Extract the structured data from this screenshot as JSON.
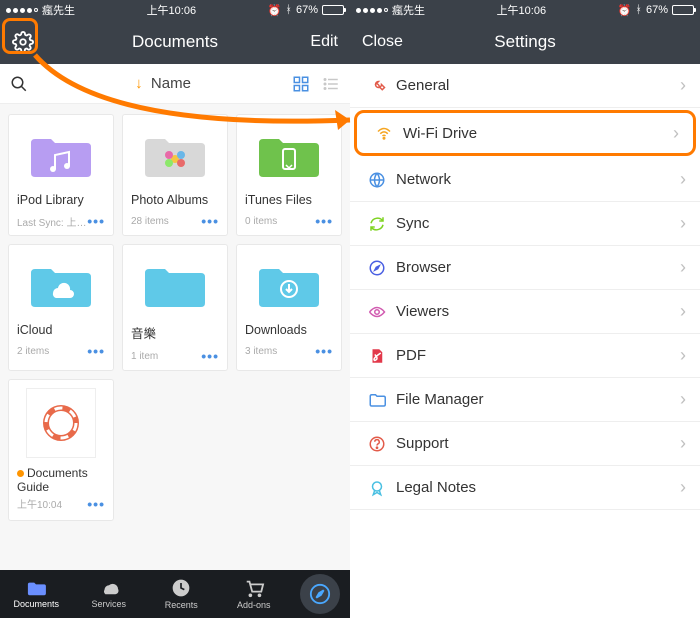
{
  "status": {
    "carrier": "瘋先生",
    "time": "上午10:06",
    "battery_pct": "67%"
  },
  "left": {
    "nav": {
      "title": "Documents",
      "edit": "Edit"
    },
    "sort": {
      "label": "Name"
    },
    "folders": [
      {
        "name": "iPod Library",
        "count": "Last Sync: 上午…",
        "color": "#b79df2",
        "icon": "music"
      },
      {
        "name": "Photo Albums",
        "count": "28 items",
        "color": "#d8d8d8",
        "icon": "flower"
      },
      {
        "name": "iTunes Files",
        "count": "0 items",
        "color": "#6fc24c",
        "icon": "phone"
      },
      {
        "name": "iCloud",
        "count": "2 items",
        "color": "#5fc9e8",
        "icon": "cloud"
      },
      {
        "name": "音樂",
        "count": "1 item",
        "color": "#5fc9e8",
        "icon": "plain"
      },
      {
        "name": "Downloads",
        "count": "3 items",
        "color": "#5fc9e8",
        "icon": "download"
      }
    ],
    "doc": {
      "name": "Documents Guide",
      "date": "上午10:04"
    },
    "tabs": [
      {
        "label": "Documents"
      },
      {
        "label": "Services"
      },
      {
        "label": "Recents"
      },
      {
        "label": "Add-ons"
      }
    ]
  },
  "right": {
    "nav": {
      "close": "Close",
      "title": "Settings"
    },
    "items": [
      {
        "label": "General",
        "icon": "wrench",
        "color": "#e25b4a"
      },
      {
        "label": "Wi-Fi Drive",
        "icon": "wifi",
        "color": "#f5a623",
        "highlighted": true
      },
      {
        "label": "Network",
        "icon": "globe",
        "color": "#4a90e2"
      },
      {
        "label": "Sync",
        "icon": "sync",
        "color": "#7ed321"
      },
      {
        "label": "Browser",
        "icon": "compass",
        "color": "#4a5fe2"
      },
      {
        "label": "Viewers",
        "icon": "eye",
        "color": "#d15bb0"
      },
      {
        "label": "PDF",
        "icon": "pdf",
        "color": "#e2384a"
      },
      {
        "label": "File Manager",
        "icon": "folder",
        "color": "#4a90e2"
      },
      {
        "label": "Support",
        "icon": "help",
        "color": "#e25b4a"
      },
      {
        "label": "Legal Notes",
        "icon": "badge",
        "color": "#4ac0e2"
      }
    ]
  }
}
